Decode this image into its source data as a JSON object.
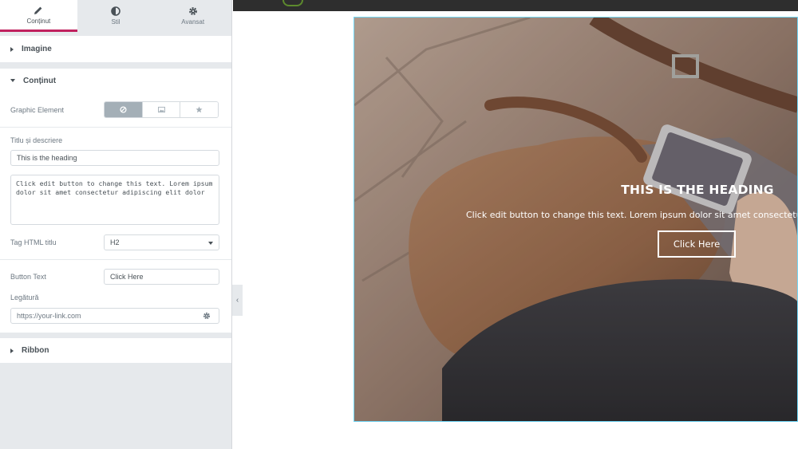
{
  "tabs": [
    {
      "label": "Conținut",
      "icon": "pencil-icon"
    },
    {
      "label": "Stil",
      "icon": "half-circle-icon"
    },
    {
      "label": "Avansat",
      "icon": "gear-icon"
    }
  ],
  "sections": {
    "imagine": "Imagine",
    "continut": "Conținut",
    "ribbon": "Ribbon"
  },
  "controls": {
    "graphic_element_label": "Graphic Element",
    "graphic_element_options": [
      "none-icon",
      "image-icon",
      "star-icon"
    ],
    "title_desc_label": "Titlu și descriere",
    "heading_value": "This is the heading",
    "description_value": "Click edit button to change this text. Lorem ipsum dolor sit amet consectetur adipiscing elit dolor",
    "tag_label": "Tag HTML titlu",
    "tag_value": "H2",
    "button_text_label": "Button Text",
    "button_text_value": "Click Here",
    "link_label": "Legătură",
    "link_placeholder": "https://your-link.com"
  },
  "preview": {
    "heading": "THIS IS THE HEADING",
    "description": "Click edit button to change this text. Lorem ipsum dolor sit amet consectetur",
    "button": "Click Here"
  },
  "colors": {
    "accent": "#c0215e",
    "panel_bg": "#e6e9ec",
    "selection_outline": "#71d7f7"
  }
}
